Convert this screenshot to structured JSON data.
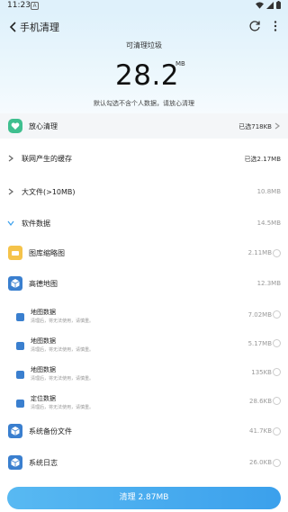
{
  "status_bar": {
    "time": "11:23",
    "notif": "A"
  },
  "header": {
    "title": "手机清理"
  },
  "summary": {
    "label": "可清理垃圾",
    "size": "28.2",
    "unit": "MB",
    "hint": "默认勾选不含个人数据，请放心清理"
  },
  "safe_clean": {
    "label": "放心清理",
    "value": "已选718KB"
  },
  "categories": [
    {
      "label": "联网产生的缓存",
      "value": "已选2.17MB"
    },
    {
      "label": "大文件(>10MB)",
      "value": "10.8MB"
    },
    {
      "label": "软件数据",
      "value": "14.5MB"
    }
  ],
  "apps": [
    {
      "label": "图库缩略图",
      "value": "2.11MB"
    },
    {
      "label": "高德地图",
      "value": "12.3MB"
    }
  ],
  "sub_items": [
    {
      "title": "地图数据",
      "desc": "清理后，将无法使用，请慎重。",
      "value": "7.02MB"
    },
    {
      "title": "地图数据",
      "desc": "清理后，将无法使用，请慎重。",
      "value": "5.17MB"
    },
    {
      "title": "地图数据",
      "desc": "清理后，将无法使用，请慎重。",
      "value": "135KB"
    },
    {
      "title": "定位数据",
      "desc": "清理后，将无法使用，请慎重。",
      "value": "28.6KB"
    }
  ],
  "bottom_apps": [
    {
      "label": "系统备份文件",
      "value": "41.7KB"
    },
    {
      "label": "系统日志",
      "value": "26.0KB"
    }
  ],
  "footer": {
    "button_label": "清理 2.87MB"
  },
  "colors": {
    "accent": "#3ba0ec",
    "safe_green": "#3fbf8f",
    "gallery_yellow": "#f5c34a",
    "app_blue": "#3a7fcf"
  }
}
